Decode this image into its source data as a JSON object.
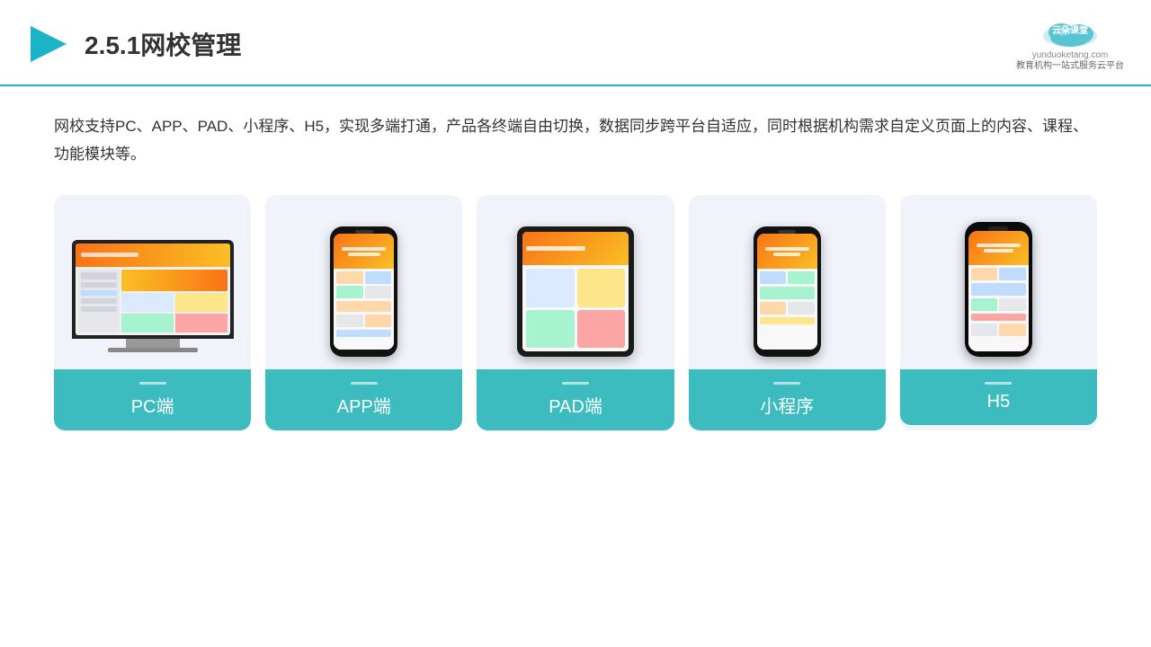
{
  "header": {
    "title": "2.5.1网校管理",
    "logo_name": "云朵课堂",
    "logo_url": "yunduoketang.com",
    "logo_subtitle": "教育机构一站\n式服务云平台"
  },
  "description": "网校支持PC、APP、PAD、小程序、H5，实现多端打通，产品各终端自由切换，数据同步跨平台自适应，同时根据机构需求自定义页面上的内容、课程、功能模块等。",
  "cards": [
    {
      "id": "pc",
      "label": "PC端"
    },
    {
      "id": "app",
      "label": "APP端"
    },
    {
      "id": "pad",
      "label": "PAD端"
    },
    {
      "id": "miniprogram",
      "label": "小程序"
    },
    {
      "id": "h5",
      "label": "H5"
    }
  ],
  "accent_color": "#3dbcbf"
}
